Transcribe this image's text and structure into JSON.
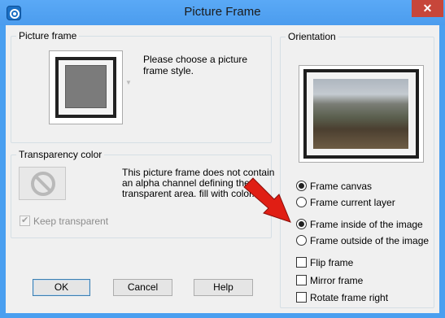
{
  "window": {
    "title": "Picture Frame",
    "close_glyph": "✕",
    "accent": "#4b9cee"
  },
  "picture_frame": {
    "group_title": "Picture frame",
    "prompt": "Please choose a picture frame style."
  },
  "transparency": {
    "group_title": "Transparency color",
    "message": "This picture frame does not contain an alpha channel defining the transparent area. fill with color.",
    "keep_transparent_label": "Keep transparent",
    "keep_transparent_checked": true,
    "keep_transparent_enabled": false
  },
  "orientation": {
    "group_title": "Orientation",
    "radios": [
      {
        "label": "Frame canvas",
        "selected": true
      },
      {
        "label": "Frame current layer",
        "selected": false
      },
      {
        "label": "Frame inside of the image",
        "selected": true
      },
      {
        "label": "Frame outside of the image",
        "selected": false
      }
    ],
    "checkboxes": [
      {
        "label": "Flip frame",
        "checked": false
      },
      {
        "label": "Mirror frame",
        "checked": false
      },
      {
        "label": "Rotate frame right",
        "checked": false
      }
    ]
  },
  "buttons": {
    "ok": "OK",
    "cancel": "Cancel",
    "help": "Help"
  },
  "annotation": {
    "arrow_color": "#e01e14"
  }
}
